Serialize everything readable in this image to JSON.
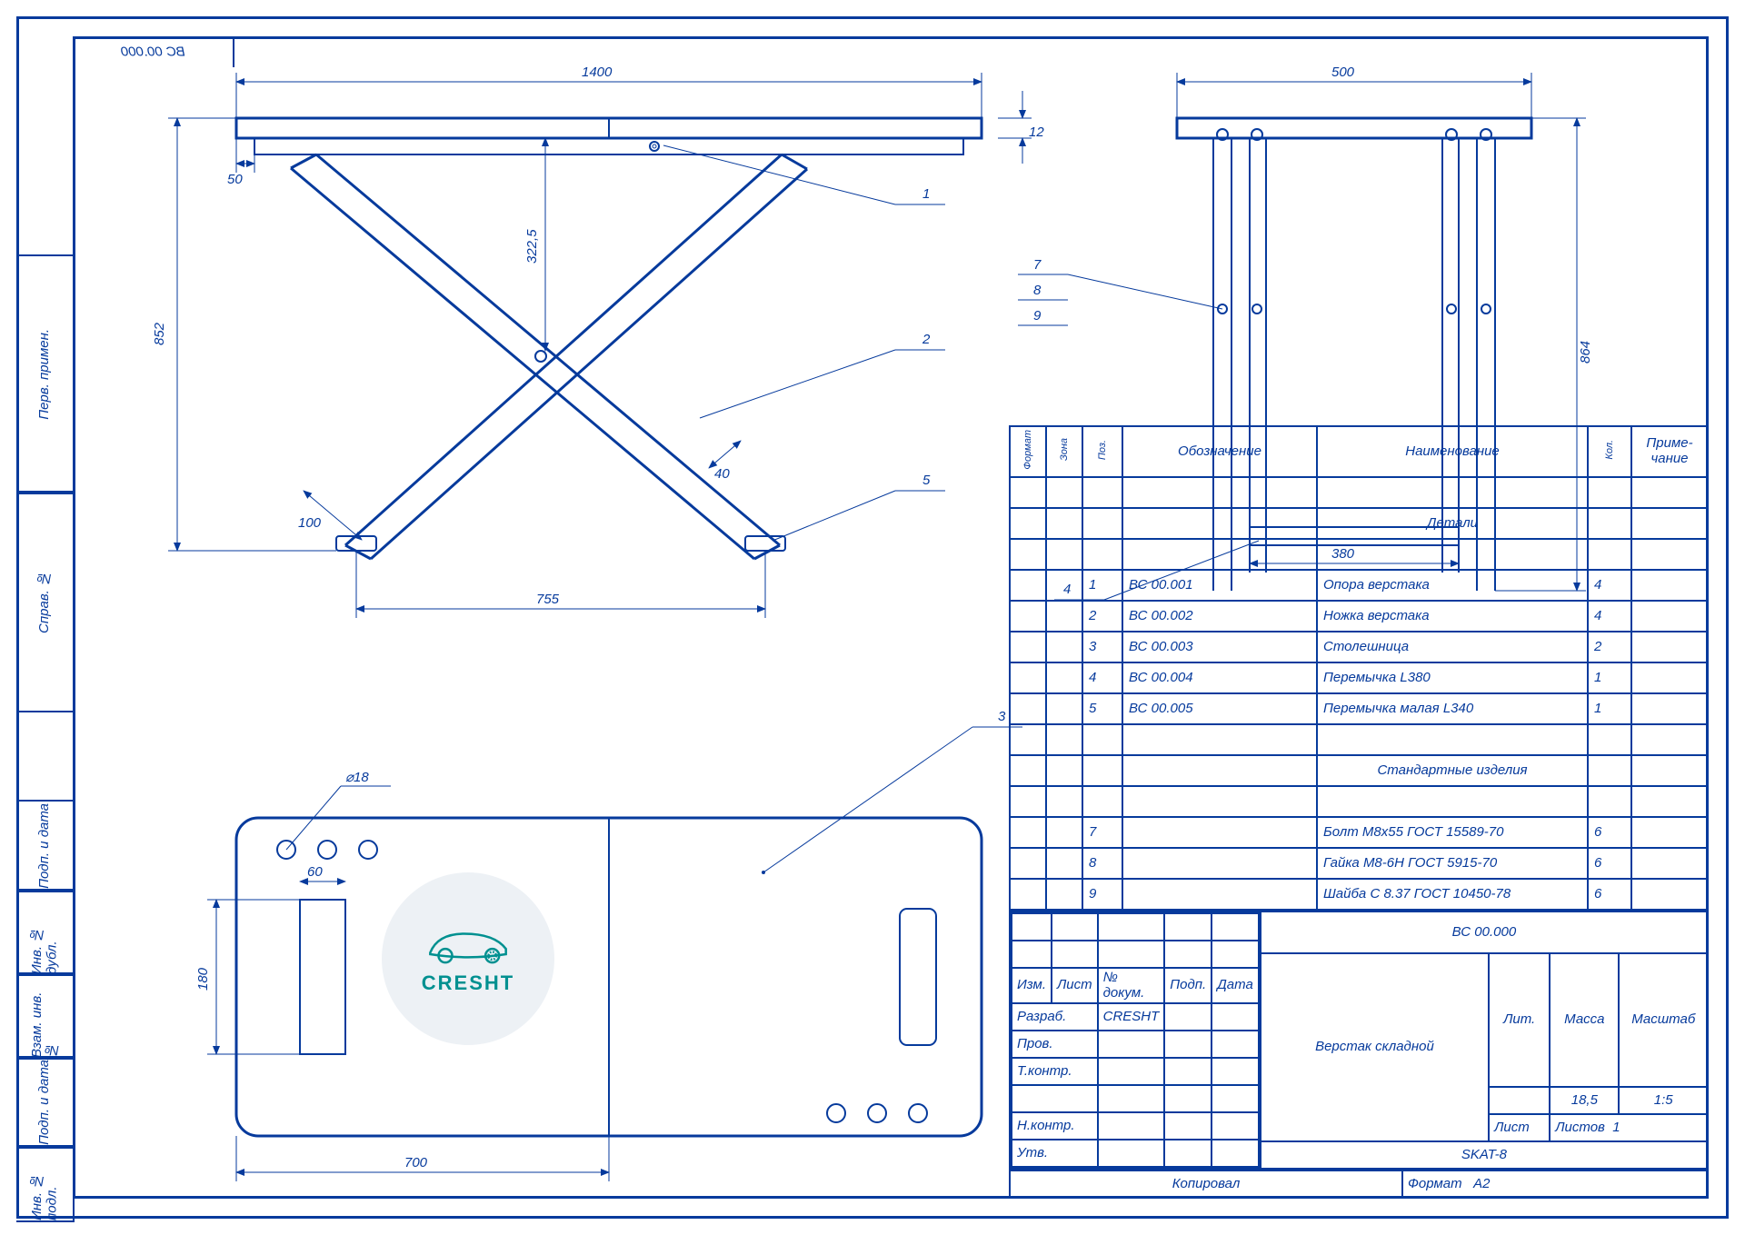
{
  "drawing_code_top": "ВС 00.000",
  "side_tabs": [
    "Перв. примен.",
    "Справ. №",
    "Подп. и дата",
    "Инв. № дубл.",
    "Взам. инв. №",
    "Подп. и дата",
    "Инв. № подл."
  ],
  "dimensions": {
    "w1400": "1400",
    "w500": "500",
    "h852": "852",
    "h864": "864",
    "t12": "12",
    "g50": "50",
    "g3225": "322,5",
    "w755": "755",
    "w100": "100",
    "g40": "40",
    "w380": "380",
    "dia18": "⌀18",
    "w60": "60",
    "h180": "180",
    "w700": "700"
  },
  "callouts": {
    "c1": "1",
    "c2": "2",
    "c3": "3",
    "c4": "4",
    "c5": "5",
    "c7": "7",
    "c8": "8",
    "c9": "9"
  },
  "bom": {
    "hdr": {
      "format": "Формат",
      "zone": "Зона",
      "pos": "Поз.",
      "desig": "Обозначение",
      "name": "Наименование",
      "qty": "Кол.",
      "note": "Приме-\nчание"
    },
    "section_parts": "Детали",
    "rows_parts": [
      {
        "pos": "1",
        "des": "ВС 00.001",
        "name": "Опора верстака",
        "qty": "4"
      },
      {
        "pos": "2",
        "des": "ВС 00.002",
        "name": "Ножка верстака",
        "qty": "4"
      },
      {
        "pos": "3",
        "des": "ВС 00.003",
        "name": "Столешница",
        "qty": "2"
      },
      {
        "pos": "4",
        "des": "ВС 00.004",
        "name": "Перемычка L380",
        "qty": "1"
      },
      {
        "pos": "5",
        "des": "ВС 00.005",
        "name": "Перемычка малая L340",
        "qty": "1"
      }
    ],
    "section_std": "Стандартные изделия",
    "rows_std": [
      {
        "pos": "7",
        "des": "",
        "name": "Болт М8х55 ГОСТ 15589-70",
        "qty": "6"
      },
      {
        "pos": "8",
        "des": "",
        "name": "Гайка М8-6Н ГОСТ 5915-70",
        "qty": "6"
      },
      {
        "pos": "9",
        "des": "",
        "name": "Шайба С 8.37 ГОСТ 10450-78",
        "qty": "6"
      }
    ]
  },
  "title": {
    "code": "ВС 00.000",
    "name": "Верстак складной",
    "brand": "SKAT-8",
    "developer_row": "Разраб.",
    "developer": "CRESHT",
    "check": "Пров.",
    "tcheck": "Т.контр.",
    "ncheck": "Н.контр.",
    "appr": "Утв.",
    "izml": "Изм.",
    "list": "Лист",
    "docno": "№ докум.",
    "sign": "Подп.",
    "date": "Дата",
    "lit": "Лит.",
    "mass": "Масса",
    "scale": "Масштаб",
    "mass_v": "18,5",
    "scale_v": "1:5",
    "sheet": "Лист",
    "sheets": "Листов",
    "sheets_v": "1",
    "copied": "Копировал",
    "format_lbl": "Формат",
    "format_v": "А2"
  },
  "logo_text": "CRESHT"
}
